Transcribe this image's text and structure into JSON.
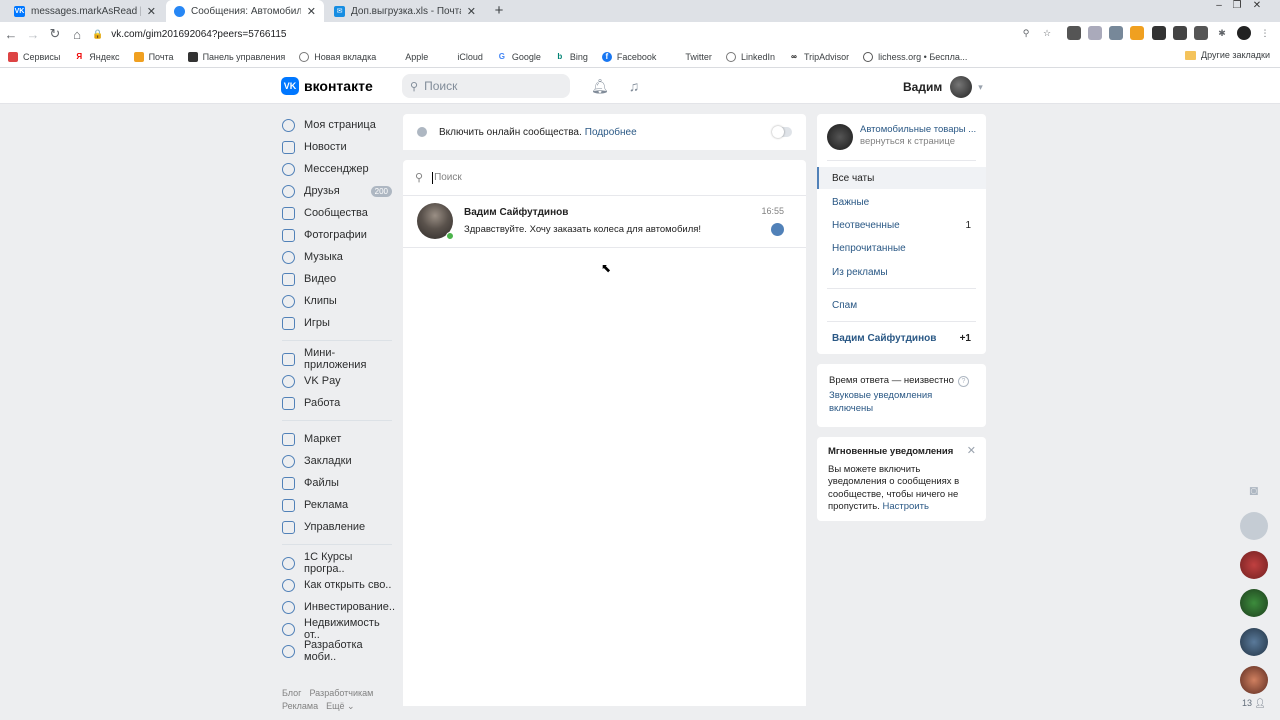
{
  "browser": {
    "tabs": [
      {
        "title": "messages.markAsRead | Разработ",
        "favicon": "vk",
        "color": "#0077ff"
      },
      {
        "title": "Сообщения: Автомобильные т",
        "favicon": "msg",
        "color": "#2787f5"
      },
      {
        "title": "Доп.выгрузка.xls - Почта Mail.ru",
        "favicon": "mail",
        "color": "#168de2"
      }
    ],
    "url": "vk.com/gim201692064?peers=5766115",
    "bookmarks": [
      {
        "label": "Сервисы",
        "icon": "apps-icon"
      },
      {
        "label": "Яндекс",
        "icon": "yandex-icon"
      },
      {
        "label": "Почта",
        "icon": "mail-icon"
      },
      {
        "label": "Панель управления",
        "icon": "panel-icon"
      },
      {
        "label": "Новая вкладка",
        "icon": "globe-icon"
      },
      {
        "label": "Apple",
        "icon": "apple-icon"
      },
      {
        "label": "iCloud",
        "icon": "apple-icon"
      },
      {
        "label": "Google",
        "icon": "google-icon"
      },
      {
        "label": "Bing",
        "icon": "bing-icon"
      },
      {
        "label": "Facebook",
        "icon": "facebook-icon"
      },
      {
        "label": "Twitter",
        "icon": "twitter-icon"
      },
      {
        "label": "LinkedIn",
        "icon": "globe-icon"
      },
      {
        "label": "TripAdvisor",
        "icon": "tripadvisor-icon"
      },
      {
        "label": "lichess.org • Беспла...",
        "icon": "lichess-icon"
      }
    ],
    "other_bookmarks": "Другие закладки"
  },
  "header": {
    "logo_mark": "VK",
    "logo_text": "вконтакте",
    "search_placeholder": "Поиск",
    "user_name": "Вадим"
  },
  "nav": {
    "group1": [
      {
        "label": "Моя страница",
        "icon": "user-icon"
      },
      {
        "label": "Новости",
        "icon": "news-icon"
      },
      {
        "label": "Мессенджер",
        "icon": "chat-icon"
      },
      {
        "label": "Друзья",
        "icon": "friends-icon",
        "badge": "200"
      },
      {
        "label": "Сообщества",
        "icon": "groups-icon"
      },
      {
        "label": "Фотографии",
        "icon": "photo-icon"
      },
      {
        "label": "Музыка",
        "icon": "music-icon"
      },
      {
        "label": "Видео",
        "icon": "video-icon"
      },
      {
        "label": "Клипы",
        "icon": "clips-icon"
      },
      {
        "label": "Игры",
        "icon": "games-icon"
      }
    ],
    "group2": [
      {
        "label": "Мини-приложения",
        "icon": "apps-icon"
      },
      {
        "label": "VK Pay",
        "icon": "vkpay-icon"
      },
      {
        "label": "Работа",
        "icon": "work-icon"
      }
    ],
    "group3": [
      {
        "label": "Маркет",
        "icon": "market-icon"
      },
      {
        "label": "Закладки",
        "icon": "star-icon"
      },
      {
        "label": "Файлы",
        "icon": "files-icon"
      },
      {
        "label": "Реклама",
        "icon": "ads-icon"
      },
      {
        "label": "Управление",
        "icon": "manage-icon"
      }
    ],
    "group4": [
      {
        "label": "1С Курсы програ..",
        "icon": "group-icon"
      },
      {
        "label": "Как открыть сво..",
        "icon": "group-icon"
      },
      {
        "label": "Инвестирование..",
        "icon": "group-icon"
      },
      {
        "label": "Недвижимость от..",
        "icon": "group-icon"
      },
      {
        "label": "Разработка моби..",
        "icon": "group-icon"
      }
    ],
    "footer": {
      "blog": "Блог",
      "devs": "Разработчикам",
      "ads": "Реклама",
      "more": "Ещё ⌄"
    }
  },
  "online_box": {
    "text": "Включить онлайн сообщества.",
    "link": "Подробнее"
  },
  "messages": {
    "search_placeholder": "Поиск",
    "dialogs": [
      {
        "name": "Вадим Сайфутдинов",
        "text": "Здравствуйте. Хочу заказать колеса для автомобиля!",
        "time": "16:55",
        "online": true,
        "unread": true
      }
    ]
  },
  "right_panel": {
    "community_name": "Автомобильные товары ...",
    "community_back": "вернуться к странице",
    "filters": [
      {
        "label": "Все чаты",
        "active": true
      },
      {
        "label": "Важные"
      },
      {
        "label": "Неотвеченные",
        "count": "1"
      },
      {
        "label": "Непрочитанные"
      },
      {
        "label": "Из рекламы"
      }
    ],
    "spam": "Спам",
    "person": {
      "label": "Вадим Сайфутдинов",
      "count": "+1"
    }
  },
  "info_box": {
    "response_time": "Время ответа — неизвестно",
    "help": "?",
    "sound_link": "Звуковые уведомления включены"
  },
  "notif_box": {
    "title": "Мгновенные уведомления",
    "body": "Вы можете включить уведомления о сообщениях в сообществе, чтобы ничего не пропустить.",
    "link": "Настроить"
  },
  "strip": {
    "count": "13"
  },
  "colors": {
    "accent": "#5181b8",
    "link": "#2a5885",
    "online": "#4bb34b",
    "bg": "#edeef0"
  }
}
